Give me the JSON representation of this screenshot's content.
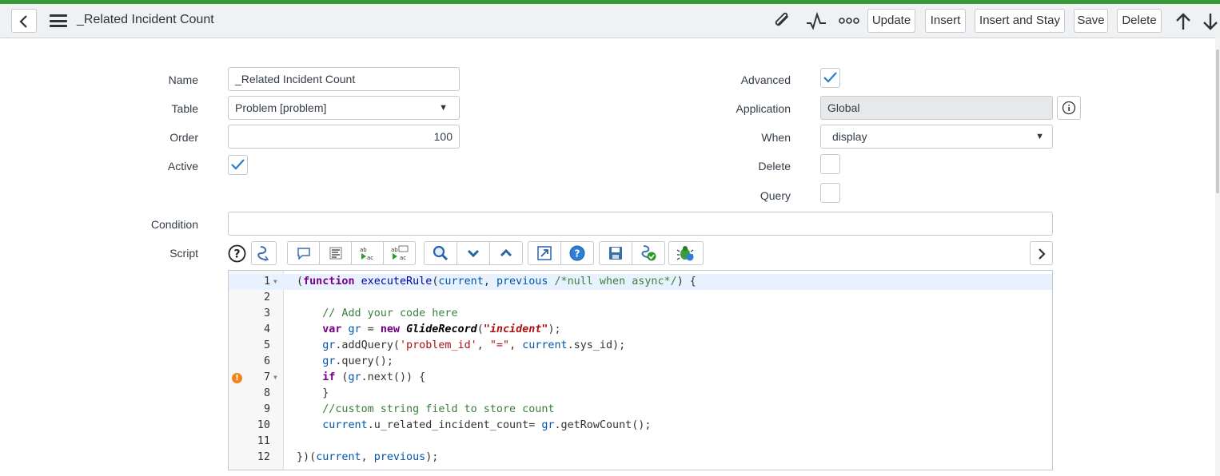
{
  "header": {
    "title": "_Related Incident Count",
    "buttons": {
      "update": "Update",
      "insert": "Insert",
      "insert_stay": "Insert and Stay",
      "save": "Save",
      "delete": "Delete"
    },
    "icons": [
      "back-icon",
      "menu-icon",
      "paperclip-icon",
      "activity-icon",
      "more-icon",
      "arrow-up-icon",
      "arrow-down-icon"
    ]
  },
  "form": {
    "name": {
      "label": "Name",
      "value": "_Related Incident Count"
    },
    "table": {
      "label": "Table",
      "value": "Problem [problem]"
    },
    "order": {
      "label": "Order",
      "value": "100"
    },
    "active": {
      "label": "Active",
      "checked": true
    },
    "advanced": {
      "label": "Advanced",
      "checked": true
    },
    "application": {
      "label": "Application",
      "value": "Global"
    },
    "when": {
      "label": "When",
      "value": "display"
    },
    "delete": {
      "label": "Delete",
      "checked": false
    },
    "query": {
      "label": "Query",
      "checked": false
    },
    "condition": {
      "label": "Condition",
      "value": ""
    },
    "script": {
      "label": "Script"
    }
  },
  "script_toolbar": [
    "help-icon",
    "format-code-icon",
    "comment-icon",
    "toggle-comment-icon",
    "replace-icon",
    "replace-all-icon",
    "search-icon",
    "collapse-icon",
    "expand-icon",
    "full-screen-icon",
    "script-help-icon",
    "save-icon",
    "syntax-check-icon",
    "debug-icon"
  ],
  "code_lines": [
    {
      "n": "1",
      "text": "(function executeRule(current, previous /*null when async*/) {"
    },
    {
      "n": "2",
      "text": ""
    },
    {
      "n": "3",
      "text": "    // Add your code here"
    },
    {
      "n": "4",
      "text": "    var gr = new GlideRecord(\"incident\");"
    },
    {
      "n": "5",
      "text": "    gr.addQuery('problem_id', \"=\", current.sys_id);"
    },
    {
      "n": "6",
      "text": "    gr.query();"
    },
    {
      "n": "7",
      "text": "    if (gr.next()) {"
    },
    {
      "n": "8",
      "text": "    }"
    },
    {
      "n": "9",
      "text": "    //custom string field to store count"
    },
    {
      "n": "10",
      "text": "    current.u_related_incident_count= gr.getRowCount();"
    },
    {
      "n": "11",
      "text": ""
    },
    {
      "n": "12",
      "text": "})(current, previous);"
    }
  ],
  "warning_glyph": "!"
}
